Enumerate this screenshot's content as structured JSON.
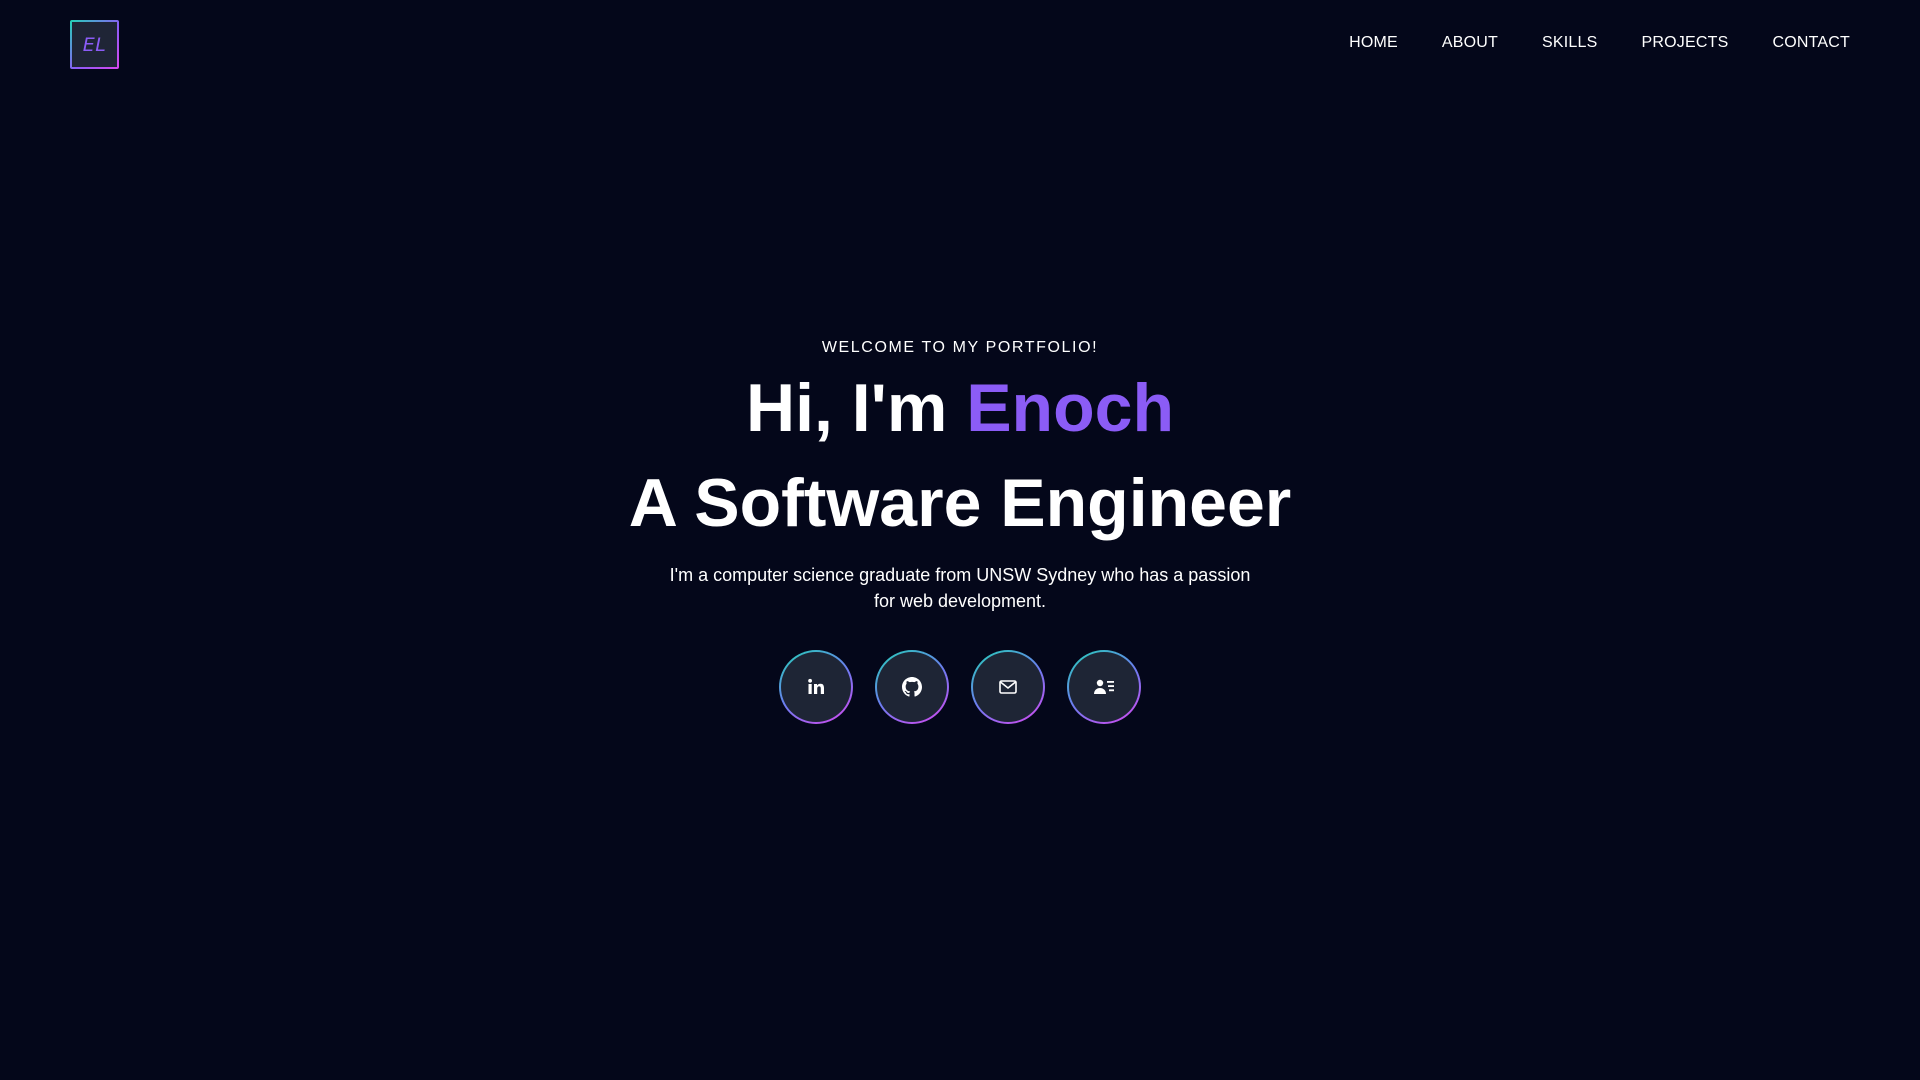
{
  "header": {
    "logo_text": "EL",
    "nav": [
      {
        "label": "HOME"
      },
      {
        "label": "ABOUT"
      },
      {
        "label": "SKILLS"
      },
      {
        "label": "PROJECTS"
      },
      {
        "label": "CONTACT"
      }
    ]
  },
  "hero": {
    "welcome": "WELCOME TO MY PORTFOLIO!",
    "greeting_prefix": "Hi, I'm ",
    "name": "Enoch",
    "role": "A Software Engineer",
    "description": "I'm a computer science graduate from UNSW Sydney who has a passion for web development."
  },
  "socials": [
    {
      "icon": "linkedin-icon"
    },
    {
      "icon": "github-icon"
    },
    {
      "icon": "mail-icon"
    },
    {
      "icon": "contact-card-icon"
    }
  ],
  "colors": {
    "background": "#04071a",
    "accent": "#8b5cf6",
    "gradient_start": "#22d3b5",
    "gradient_end": "#d946ef",
    "button_fill": "#1e2535"
  }
}
